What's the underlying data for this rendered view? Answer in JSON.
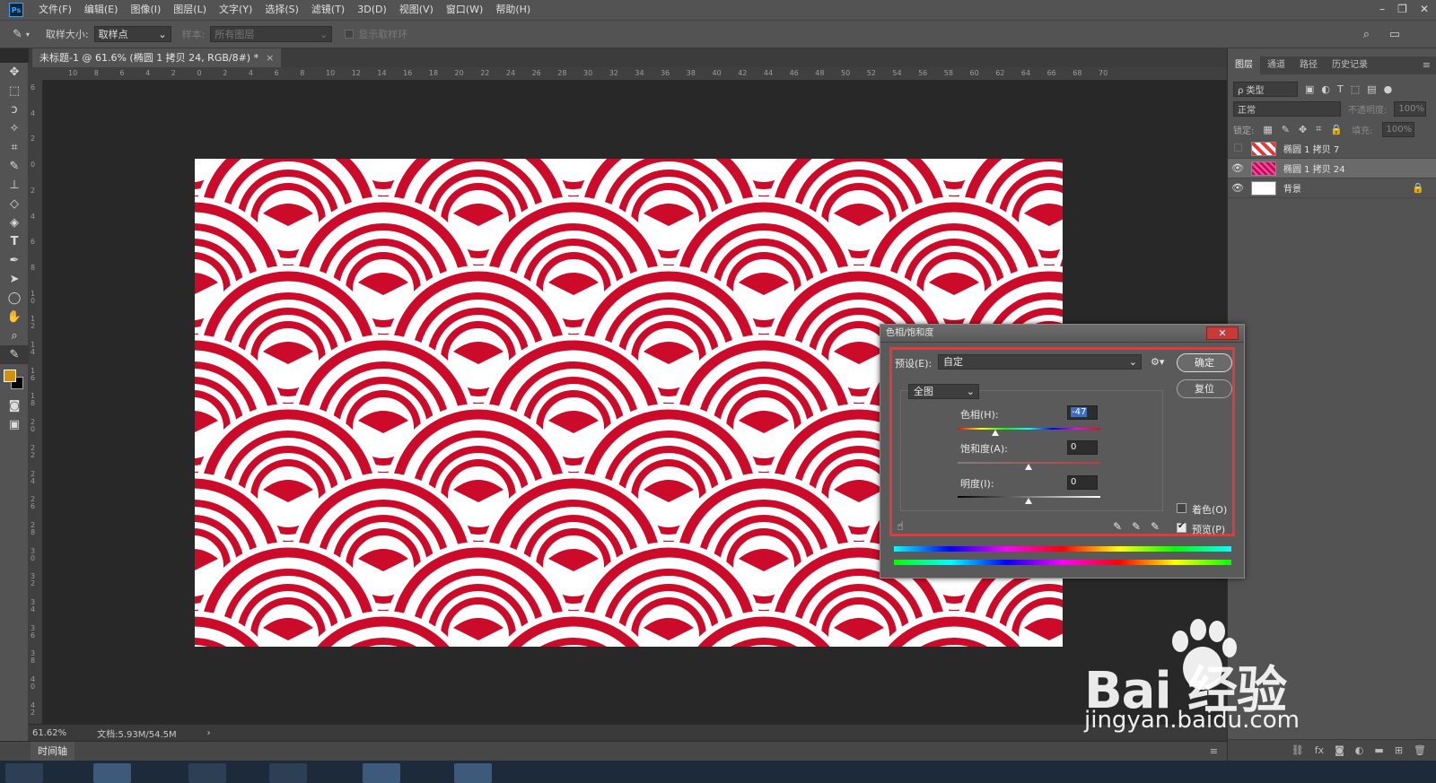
{
  "app": {
    "logo": "Ps",
    "menu": [
      "文件(F)",
      "编辑(E)",
      "图像(I)",
      "图层(L)",
      "文字(Y)",
      "选择(S)",
      "滤镜(T)",
      "3D(D)",
      "视图(V)",
      "窗口(W)",
      "帮助(H)"
    ],
    "window_controls": [
      "–",
      "❐",
      "✕"
    ]
  },
  "options": {
    "sample_size_label": "取样大小:",
    "sample_size_value": "取样点",
    "sample_label": "样本:",
    "sample_value": "所有图层",
    "show_ring_label": "显示取样环"
  },
  "document": {
    "tab_title": "未标题-1 @ 61.6% (椭圆 1 拷贝 24, RGB/8#) *",
    "tab_close": "×",
    "zoom": "61.62%",
    "doc_size": "文档:5.93M/54.5M",
    "status_arrow": "›"
  },
  "ruler": {
    "h_ticks": [
      "10",
      "8",
      "6",
      "4",
      "2",
      "0",
      "2",
      "4",
      "6",
      "8",
      "10",
      "12",
      "14",
      "16",
      "18",
      "20",
      "22",
      "24",
      "26",
      "28",
      "30",
      "32",
      "34",
      "36",
      "38",
      "40",
      "42",
      "44",
      "46",
      "48",
      "50",
      "52",
      "54",
      "56",
      "58",
      "60",
      "62",
      "64",
      "66",
      "68",
      "70"
    ],
    "v_ticks": [
      "6",
      "4",
      "2",
      "0",
      "2",
      "4",
      "6",
      "8",
      "1 0",
      "1 2",
      "1 4",
      "1 6",
      "1 8",
      "2 0",
      "2 2",
      "2 4",
      "2 6",
      "2 8",
      "3 0",
      "3 2",
      "3 4",
      "3 6",
      "3 8",
      "4 0",
      "4 2",
      "4 4"
    ]
  },
  "timeline": {
    "label": "时间轴"
  },
  "panel": {
    "tabs": [
      "图层",
      "通道",
      "路径",
      "历史记录"
    ],
    "filter_label": "ρ 类型",
    "blend_mode": "正常",
    "opacity_label": "不透明度:",
    "opacity_value": "100%",
    "lock_label": "锁定:",
    "fill_label": "填充:",
    "fill_value": "100%",
    "layers": [
      {
        "name": "椭圆 1 拷贝 7",
        "visible": false,
        "selected": false,
        "locked": false
      },
      {
        "name": "椭圆 1 拷贝 24",
        "visible": true,
        "selected": true,
        "locked": false
      },
      {
        "name": "背景",
        "visible": true,
        "selected": false,
        "locked": true
      }
    ]
  },
  "dialog": {
    "title": "色相/饱和度",
    "close": "✕",
    "preset_label": "预设(E):",
    "preset_value": "自定",
    "ok": "确定",
    "reset": "复位",
    "channel": "全图",
    "hue_label": "色相(H):",
    "hue_value": "-47",
    "saturation_label": "饱和度(A):",
    "saturation_value": "0",
    "lightness_label": "明度(I):",
    "lightness_value": "0",
    "colorize_label": "着色(O)",
    "colorize_checked": false,
    "preview_label": "预览(P)",
    "preview_checked": true
  },
  "watermark": {
    "brand": "Bai 经验",
    "url": "jingyan.baidu.com"
  },
  "colors": {
    "foreground": "#d4900c",
    "background": "#000000",
    "pattern_red": "#cc0a2a",
    "highlight_red": "#e03a3a"
  }
}
